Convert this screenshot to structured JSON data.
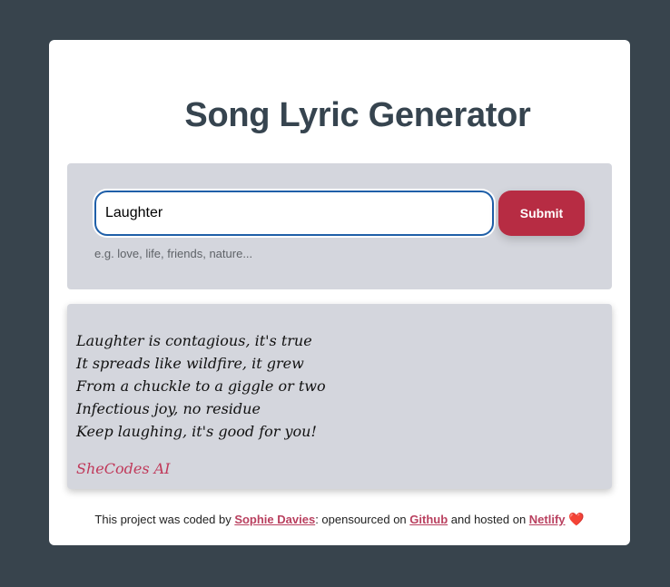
{
  "header": {
    "title": "Song Lyric Generator"
  },
  "form": {
    "input_value": "Laughter",
    "submit_label": "Submit",
    "hint": "e.g. love, life, friends, nature..."
  },
  "poem": {
    "lines": [
      "Laughter is contagious, it's true",
      "It spreads like wildfire, it grew",
      "From a chuckle to a giggle or two",
      "Infectious joy, no residue",
      "Keep laughing, it's good for you!"
    ],
    "signature": "SheCodes AI"
  },
  "footer": {
    "text_before": "This project was coded by ",
    "author_link": "Sophie Davies",
    "text_middle": ": opensourced on ",
    "github_link": "Github",
    "text_after": " and hosted on ",
    "netlify_link": "Netlify",
    "heart_icon": "❤️"
  },
  "colors": {
    "background": "#38444d",
    "card": "#ffffff",
    "panel": "#d4d6dd",
    "accent": "#b72c43",
    "link": "#b9405f",
    "input_border": "#1f5fa8"
  }
}
